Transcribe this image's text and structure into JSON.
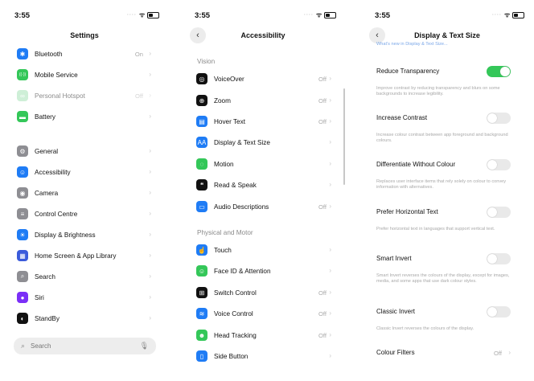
{
  "status": {
    "time": "3:55"
  },
  "settings": {
    "title": "Settings",
    "rows": [
      {
        "label": "Bluetooth",
        "value": "On",
        "icon": "bluetooth-icon",
        "color": "#1f7cf5",
        "glyph": "✱"
      },
      {
        "label": "Mobile Service",
        "value": "",
        "icon": "antenna-icon",
        "color": "#34c759",
        "glyph": "((·))"
      },
      {
        "label": "Personal Hotspot",
        "value": "Off",
        "icon": "hotspot-icon",
        "color": "#9fe0b1",
        "glyph": "∞"
      },
      {
        "label": "Battery",
        "value": "",
        "icon": "battery-icon",
        "color": "#34c759",
        "glyph": "▬"
      },
      {
        "label": "General",
        "value": "",
        "icon": "gear-icon",
        "color": "#8e8e93",
        "glyph": "⚙"
      },
      {
        "label": "Accessibility",
        "value": "",
        "icon": "accessibility-icon",
        "color": "#1f7cf5",
        "glyph": "☺"
      },
      {
        "label": "Camera",
        "value": "",
        "icon": "camera-icon",
        "color": "#8e8e93",
        "glyph": "◉"
      },
      {
        "label": "Control Centre",
        "value": "",
        "icon": "control-centre-icon",
        "color": "#8e8e93",
        "glyph": "≡"
      },
      {
        "label": "Display & Brightness",
        "value": "",
        "icon": "sun-icon",
        "color": "#1f7cf5",
        "glyph": "☀"
      },
      {
        "label": "Home Screen & App Library",
        "value": "",
        "icon": "home-screen-icon",
        "color": "#3b5bdb",
        "glyph": "▦"
      },
      {
        "label": "Search",
        "value": "",
        "icon": "search-icon",
        "color": "#8e8e93",
        "glyph": "⌕"
      },
      {
        "label": "Siri",
        "value": "",
        "icon": "siri-icon",
        "color": "#7b2ff7",
        "glyph": "●"
      },
      {
        "label": "StandBy",
        "value": "",
        "icon": "standby-icon",
        "color": "#111111",
        "glyph": "◐"
      }
    ],
    "search_placeholder": "Search"
  },
  "accessibility": {
    "title": "Accessibility",
    "section_vision": "Vision",
    "section_physical": "Physical and Motor",
    "vision_rows": [
      {
        "label": "VoiceOver",
        "value": "Off",
        "icon": "voiceover-icon",
        "color": "#111111",
        "glyph": "◎"
      },
      {
        "label": "Zoom",
        "value": "Off",
        "icon": "zoom-icon",
        "color": "#111111",
        "glyph": "⊕"
      },
      {
        "label": "Hover Text",
        "value": "Off",
        "icon": "hover-text-icon",
        "color": "#1f7cf5",
        "glyph": "▤"
      },
      {
        "label": "Display & Text Size",
        "value": "",
        "icon": "text-size-icon",
        "color": "#1f7cf5",
        "glyph": "AA"
      },
      {
        "label": "Motion",
        "value": "",
        "icon": "motion-icon",
        "color": "#34c759",
        "glyph": "◌"
      },
      {
        "label": "Read & Speak",
        "value": "",
        "icon": "speech-icon",
        "color": "#111111",
        "glyph": "❝"
      },
      {
        "label": "Audio Descriptions",
        "value": "Off",
        "icon": "audio-description-icon",
        "color": "#1f7cf5",
        "glyph": "▭"
      }
    ],
    "physical_rows": [
      {
        "label": "Touch",
        "value": "",
        "icon": "touch-icon",
        "color": "#1f7cf5",
        "glyph": "☝"
      },
      {
        "label": "Face ID & Attention",
        "value": "",
        "icon": "face-id-icon",
        "color": "#34c759",
        "glyph": "☺"
      },
      {
        "label": "Switch Control",
        "value": "Off",
        "icon": "switch-control-icon",
        "color": "#111111",
        "glyph": "⊞"
      },
      {
        "label": "Voice Control",
        "value": "Off",
        "icon": "voice-control-icon",
        "color": "#1f7cf5",
        "glyph": "≋"
      },
      {
        "label": "Head Tracking",
        "value": "Off",
        "icon": "head-tracking-icon",
        "color": "#34c759",
        "glyph": "☻"
      },
      {
        "label": "Side Button",
        "value": "",
        "icon": "side-button-icon",
        "color": "#1f7cf5",
        "glyph": "▯"
      }
    ]
  },
  "display_text": {
    "title": "Display & Text Size",
    "top_link": "What's new in Display & Text Size...",
    "options": [
      {
        "label": "Reduce Transparency",
        "on": true,
        "desc": "Improve contrast by reducing transparency and blurs on some backgrounds to increase legibility."
      },
      {
        "label": "Increase Contrast",
        "on": false,
        "desc": "Increase colour contrast between app foreground and background colours."
      },
      {
        "label": "Differentiate Without Colour",
        "on": false,
        "desc": "Replaces user interface items that rely solely on colour to convey information with alternatives."
      },
      {
        "label": "Prefer Horizontal Text",
        "on": false,
        "desc": "Prefer horizontal text in languages that support vertical text."
      },
      {
        "label": "Smart Invert",
        "on": false,
        "desc": "Smart Invert reverses the colours of the display, except for images, media, and some apps that use dark colour styles."
      },
      {
        "label": "Classic Invert",
        "on": false,
        "desc": "Classic Invert reverses the colours of the display."
      }
    ],
    "colour_filters": {
      "label": "Colour Filters",
      "value": "Off"
    }
  }
}
